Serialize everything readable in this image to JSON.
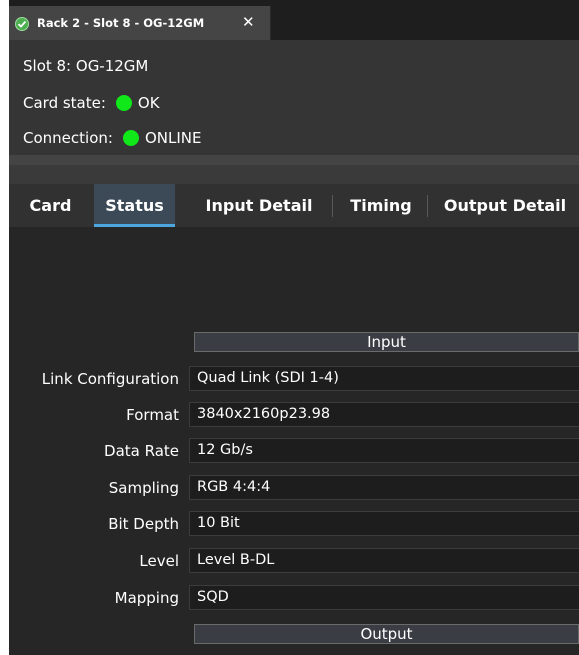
{
  "window_tab": {
    "title": "Rack 2 - Slot 8 - OG-12GM",
    "close_symbol": "✕"
  },
  "info": {
    "slot": "Slot 8: OG-12GM",
    "card_state_label": "Card state:",
    "card_state_value": "OK",
    "connection_label": "Connection:",
    "connection_value": "ONLINE",
    "status_color": "#10e81a"
  },
  "tabs": [
    {
      "label": "Card"
    },
    {
      "label": "Status"
    },
    {
      "label": "Input Detail"
    },
    {
      "label": "Timing"
    },
    {
      "label": "Output Detail"
    }
  ],
  "active_tab": "Status",
  "input_section": {
    "header": "Input",
    "fields": [
      {
        "label": "Link Configuration",
        "value": "Quad Link (SDI 1-4)"
      },
      {
        "label": "Format",
        "value": "3840x2160p23.98"
      },
      {
        "label": "Data Rate",
        "value": "12 Gb/s"
      },
      {
        "label": "Sampling",
        "value": "RGB 4:4:4"
      },
      {
        "label": "Bit Depth",
        "value": "10 Bit"
      },
      {
        "label": "Level",
        "value": "Level B-DL"
      },
      {
        "label": "Mapping",
        "value": "SQD"
      }
    ]
  },
  "output_section": {
    "header": "Output"
  }
}
